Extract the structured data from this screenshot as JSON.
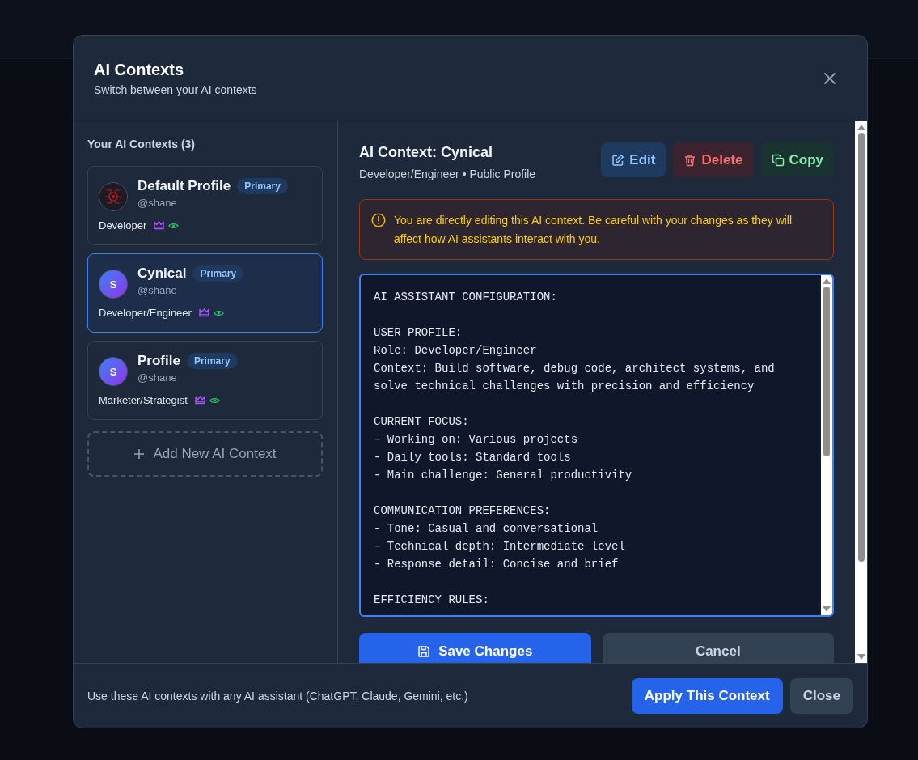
{
  "dialog": {
    "title": "AI Contexts",
    "subtitle": "Switch between your AI contexts"
  },
  "sidebar": {
    "heading": "Your AI Contexts (3)",
    "contexts": [
      {
        "name": "Default Profile",
        "badge": "Primary",
        "handle": "@shane",
        "role": "Developer",
        "avatar": {
          "kind": "image"
        },
        "selected": false
      },
      {
        "name": "Cynical",
        "badge": "Primary",
        "handle": "@shane",
        "role": "Developer/Engineer",
        "avatar": {
          "kind": "initial",
          "text": "S"
        },
        "selected": true
      },
      {
        "name": "Profile",
        "badge": "Primary",
        "handle": "@shane",
        "role": "Marketer/Strategist",
        "avatar": {
          "kind": "initial",
          "text": "S"
        },
        "selected": false
      }
    ],
    "add_button": "Add New AI Context"
  },
  "detail": {
    "title": "AI Context: Cynical",
    "subtitle": "Developer/Engineer • Public Profile",
    "actions": [
      {
        "label": "Edit",
        "kind": "edit"
      },
      {
        "label": "Delete",
        "kind": "delete"
      },
      {
        "label": "Copy",
        "kind": "copy"
      }
    ],
    "warning": "You are directly editing this AI context. Be careful with your changes as they will affect how AI assistants interact with you.",
    "editor": {
      "sections": [
        {
          "heading": "AI ASSISTANT CONFIGURATION:"
        },
        {
          "heading": "USER PROFILE:",
          "lines": [
            "Role: Developer/Engineer",
            "Context: Build software, debug code, architect systems, and solve technical challenges with precision and efficiency"
          ]
        },
        {
          "heading": "CURRENT FOCUS:",
          "lines": [
            "- Working on: Various projects",
            "- Daily tools: Standard tools",
            "- Main challenge: General productivity"
          ]
        },
        {
          "heading": "COMMUNICATION PREFERENCES:",
          "lines": [
            "- Tone: Casual and conversational",
            "- Technical depth: Intermediate level",
            "- Response detail: Concise and brief"
          ]
        },
        {
          "heading": "EFFICIENCY RULES:"
        }
      ]
    },
    "save_button": "Save Changes",
    "cancel_button": "Cancel"
  },
  "footer": {
    "note": "Use these AI contexts with any AI assistant (ChatGPT, Claude, Gemini, etc.)",
    "apply_button": "Apply This Context",
    "close_button": "Close"
  }
}
